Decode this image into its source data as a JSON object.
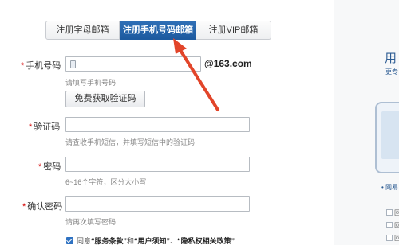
{
  "tabs": [
    {
      "label": "注册字母邮箱"
    },
    {
      "label": "注册手机号码邮箱"
    },
    {
      "label": "注册VIP邮箱"
    }
  ],
  "form": {
    "phone": {
      "label": "手机号码",
      "value": "",
      "hint": "请填写手机号码",
      "suffix": "@163.com"
    },
    "get_code_button": "免费获取验证码",
    "code": {
      "label": "验证码",
      "value": "",
      "hint": "请查收手机短信，并填写短信中的验证码"
    },
    "password": {
      "label": "密码",
      "value": "",
      "hint": "6~16个字符，区分大小写"
    },
    "confirm": {
      "label": "确认密码",
      "value": "",
      "hint": "请再次填写密码"
    },
    "required_mark": "*",
    "agreement": {
      "prefix": "同意",
      "terms": "“服务条款”",
      "and": "和",
      "notice": "“用户须知”",
      "sep": "、",
      "privacy": "“隐私权相关政策”",
      "checked": true
    }
  },
  "sidebar": {
    "title": "用",
    "subtitle": "更专",
    "link": "• 网易",
    "checks": [
      "回",
      "回",
      "回"
    ]
  },
  "colors": {
    "accent": "#1d5a9f",
    "arrow": "#e2452a",
    "required": "#d40000"
  }
}
